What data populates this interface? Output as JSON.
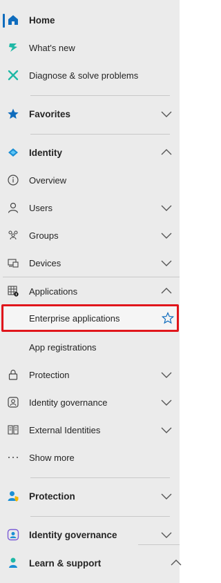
{
  "nav": {
    "home": "Home",
    "whats_new": "What's new",
    "diagnose": "Diagnose & solve problems",
    "favorites": "Favorites",
    "identity": "Identity",
    "overview": "Overview",
    "users": "Users",
    "groups": "Groups",
    "devices": "Devices",
    "applications": "Applications",
    "enterprise_apps": "Enterprise applications",
    "app_registrations": "App registrations",
    "protection_sub": "Protection",
    "identity_governance_sub": "Identity governance",
    "external_identities": "External Identities",
    "show_more": "Show more",
    "protection": "Protection",
    "identity_governance": "Identity governance",
    "learn_support": "Learn & support"
  },
  "colors": {
    "accent": "#0f6cbd",
    "highlight": "#e0151b",
    "teal": "#1fb8a6"
  }
}
